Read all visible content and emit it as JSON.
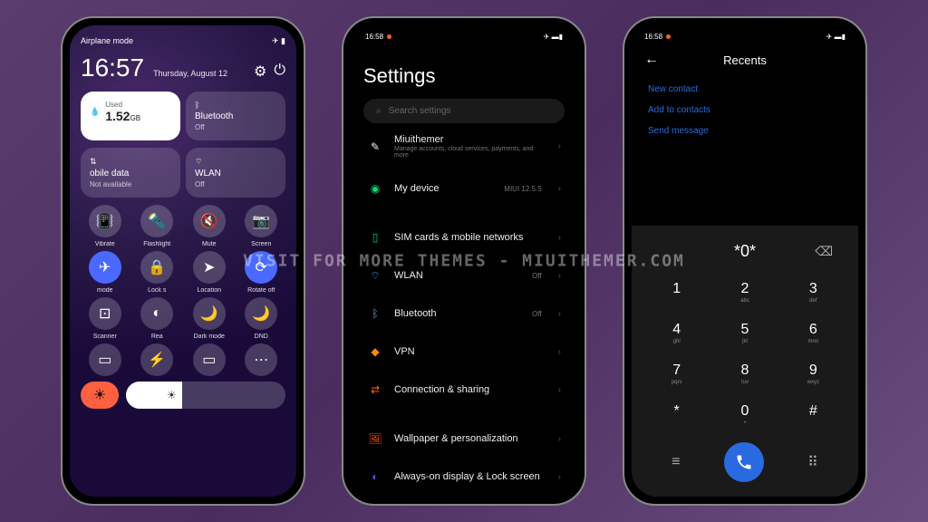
{
  "watermark": "VISIT FOR MORE THEMES - MIUITHEMER.COM",
  "phone1": {
    "status_left": "Airplane mode",
    "clock": "16:57",
    "date": "Thursday, August 12",
    "data_tile": {
      "label": "Used",
      "value": "1.52",
      "unit": "GB"
    },
    "bluetooth": {
      "title": "Bluetooth",
      "sub": "Off"
    },
    "mobile": {
      "title": "obile data",
      "sub": "Not available"
    },
    "wlan": {
      "title": "WLAN",
      "sub": "Off"
    },
    "qs_row1": [
      "Vibrate",
      "Flashlight",
      "Mute",
      "Screen"
    ],
    "qs_row2": [
      "mode",
      "Lock s",
      "Location",
      "Rotate off"
    ],
    "qs_row3": [
      "Scanner",
      "Rea",
      "Dark mode",
      "DND"
    ]
  },
  "phone2": {
    "time": "16:58",
    "title": "Settings",
    "search_placeholder": "Search settings",
    "account": {
      "title": "Miuithemer",
      "sub": "Manage accounts, cloud services, payments, and more"
    },
    "my_device": {
      "title": "My device",
      "right": "MIUI 12.5.5"
    },
    "items": [
      {
        "title": "SIM cards & mobile networks",
        "right": ""
      },
      {
        "title": "WLAN",
        "right": "Off"
      },
      {
        "title": "Bluetooth",
        "right": "Off"
      },
      {
        "title": "VPN",
        "right": ""
      },
      {
        "title": "Connection & sharing",
        "right": ""
      }
    ],
    "items2": [
      {
        "title": "Wallpaper & personalization"
      },
      {
        "title": "Always-on display & Lock screen"
      }
    ]
  },
  "phone3": {
    "time": "16:58",
    "title": "Recents",
    "links": [
      "New contact",
      "Add to contacts",
      "Send message"
    ],
    "display": "*0*",
    "keys": [
      [
        {
          "n": "1",
          "l": ""
        },
        {
          "n": "2",
          "l": "abc"
        },
        {
          "n": "3",
          "l": "def"
        }
      ],
      [
        {
          "n": "4",
          "l": "ghi"
        },
        {
          "n": "5",
          "l": "jkl"
        },
        {
          "n": "6",
          "l": "mno"
        }
      ],
      [
        {
          "n": "7",
          "l": "pqrs"
        },
        {
          "n": "8",
          "l": "tuv"
        },
        {
          "n": "9",
          "l": "wxyz"
        }
      ],
      [
        {
          "n": "*",
          "l": ""
        },
        {
          "n": "0",
          "l": "+"
        },
        {
          "n": "#",
          "l": ""
        }
      ]
    ]
  }
}
